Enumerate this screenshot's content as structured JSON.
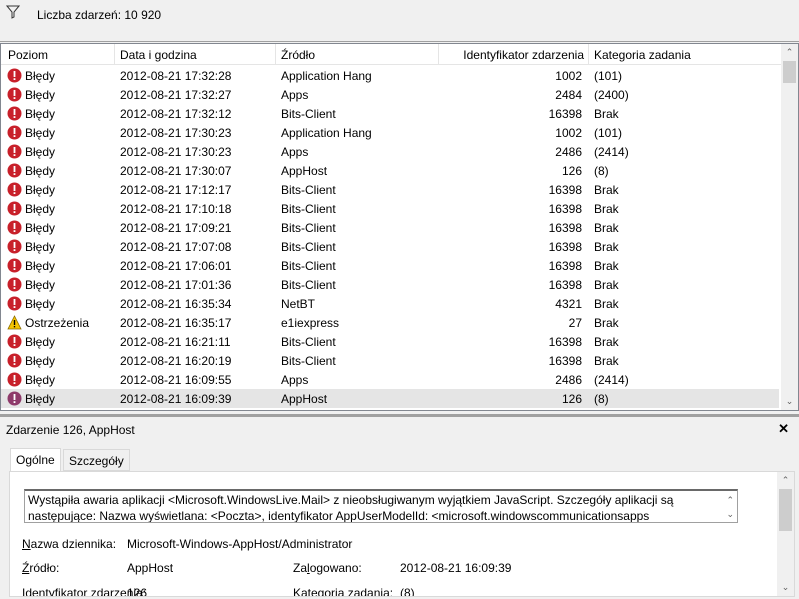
{
  "toolbar": {
    "filter_icon": "funnel-icon",
    "event_count": "Liczba zdarzeń: 10 920"
  },
  "table": {
    "columns": [
      "Poziom",
      "Data i godzina",
      "Źródło",
      "Identyfikator zdarzenia",
      "Kategoria zadania"
    ],
    "selected_index": 17,
    "rows": [
      {
        "level": "Błędy",
        "icon": "error",
        "date": "2012-08-21 17:32:28",
        "source": "Application Hang",
        "id": "1002",
        "category": "(101)"
      },
      {
        "level": "Błędy",
        "icon": "error",
        "date": "2012-08-21 17:32:27",
        "source": "Apps",
        "id": "2484",
        "category": "(2400)"
      },
      {
        "level": "Błędy",
        "icon": "error",
        "date": "2012-08-21 17:32:12",
        "source": "Bits-Client",
        "id": "16398",
        "category": "Brak"
      },
      {
        "level": "Błędy",
        "icon": "error",
        "date": "2012-08-21 17:30:23",
        "source": "Application Hang",
        "id": "1002",
        "category": "(101)"
      },
      {
        "level": "Błędy",
        "icon": "error",
        "date": "2012-08-21 17:30:23",
        "source": "Apps",
        "id": "2486",
        "category": "(2414)"
      },
      {
        "level": "Błędy",
        "icon": "error",
        "date": "2012-08-21 17:30:07",
        "source": "AppHost",
        "id": "126",
        "category": "(8)"
      },
      {
        "level": "Błędy",
        "icon": "error",
        "date": "2012-08-21 17:12:17",
        "source": "Bits-Client",
        "id": "16398",
        "category": "Brak"
      },
      {
        "level": "Błędy",
        "icon": "error",
        "date": "2012-08-21 17:10:18",
        "source": "Bits-Client",
        "id": "16398",
        "category": "Brak"
      },
      {
        "level": "Błędy",
        "icon": "error",
        "date": "2012-08-21 17:09:21",
        "source": "Bits-Client",
        "id": "16398",
        "category": "Brak"
      },
      {
        "level": "Błędy",
        "icon": "error",
        "date": "2012-08-21 17:07:08",
        "source": "Bits-Client",
        "id": "16398",
        "category": "Brak"
      },
      {
        "level": "Błędy",
        "icon": "error",
        "date": "2012-08-21 17:06:01",
        "source": "Bits-Client",
        "id": "16398",
        "category": "Brak"
      },
      {
        "level": "Błędy",
        "icon": "error",
        "date": "2012-08-21 17:01:36",
        "source": "Bits-Client",
        "id": "16398",
        "category": "Brak"
      },
      {
        "level": "Błędy",
        "icon": "error",
        "date": "2012-08-21 16:35:34",
        "source": "NetBT",
        "id": "4321",
        "category": "Brak"
      },
      {
        "level": "Ostrzeżenia",
        "icon": "warning",
        "date": "2012-08-21 16:35:17",
        "source": "e1iexpress",
        "id": "27",
        "category": "Brak"
      },
      {
        "level": "Błędy",
        "icon": "error",
        "date": "2012-08-21 16:21:11",
        "source": "Bits-Client",
        "id": "16398",
        "category": "Brak"
      },
      {
        "level": "Błędy",
        "icon": "error",
        "date": "2012-08-21 16:20:19",
        "source": "Bits-Client",
        "id": "16398",
        "category": "Brak"
      },
      {
        "level": "Błędy",
        "icon": "error",
        "date": "2012-08-21 16:09:55",
        "source": "Apps",
        "id": "2486",
        "category": "(2414)"
      },
      {
        "level": "Błędy",
        "icon": "error",
        "date": "2012-08-21 16:09:39",
        "source": "AppHost",
        "id": "126",
        "category": "(8)"
      }
    ]
  },
  "colors": {
    "error": "#c8202a",
    "warning": "#f5c400",
    "selected_row": "#e5e5e5"
  },
  "detail": {
    "title": "Zdarzenie 126, AppHost",
    "close_icon": "close-icon",
    "tabs": [
      "Ogólne",
      "Szczegóły"
    ],
    "active_tab": "Ogólne",
    "message": "Wystąpiła awaria aplikacji <Microsoft.WindowsLive.Mail> z nieobsługiwanym wyjątkiem JavaScript. Szczegóły aplikacji są następujące: Nazwa wyświetlana: <Poczta>, identyfikator AppUserModelId: <microsoft.windowscommunicationsapps",
    "fields": {
      "log_name_label": "azwa dziennika:",
      "log_name_key": "N",
      "log_name": "Microsoft-Windows-AppHost/Administrator",
      "source_label": "ródło:",
      "source_key": "Ź",
      "source": "AppHost",
      "logged_label_pre": "Za",
      "logged_key": "l",
      "logged_label_post": "ogowano:",
      "logged": "2012-08-21 16:09:39",
      "event_id_label": "Identyfikator zdarzenia:",
      "event_id": "126",
      "task_label": "Kategoria zadania:",
      "task": "(8)"
    }
  }
}
